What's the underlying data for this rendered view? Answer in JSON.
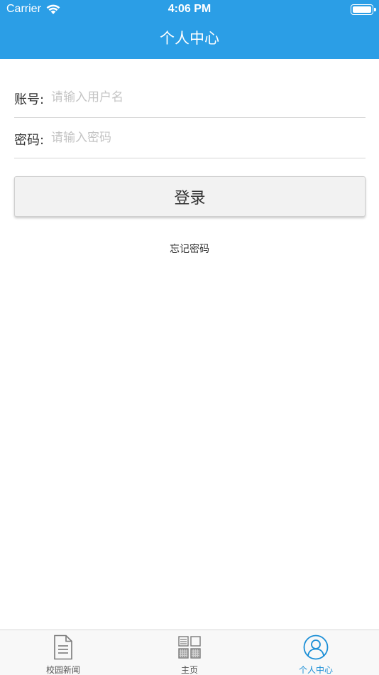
{
  "status_bar": {
    "carrier": "Carrier",
    "time": "4:06 PM"
  },
  "nav": {
    "title": "个人中心"
  },
  "form": {
    "account_label": "账号:",
    "account_placeholder": "请输入用户名",
    "account_value": "",
    "password_label": "密码:",
    "password_placeholder": "请输入密码",
    "password_value": "",
    "login_label": "登录",
    "forgot_label": "忘记密码"
  },
  "tabbar": {
    "items": [
      {
        "label": "校园新闻",
        "icon": "document-icon",
        "selected": false
      },
      {
        "label": "主页",
        "icon": "grid-icon",
        "selected": false
      },
      {
        "label": "个人中心",
        "icon": "user-circle-icon",
        "selected": true
      }
    ]
  },
  "colors": {
    "header_bg": "#2b9ee6",
    "active_tab": "#1a8ed6",
    "inactive_tab": "#555555"
  }
}
